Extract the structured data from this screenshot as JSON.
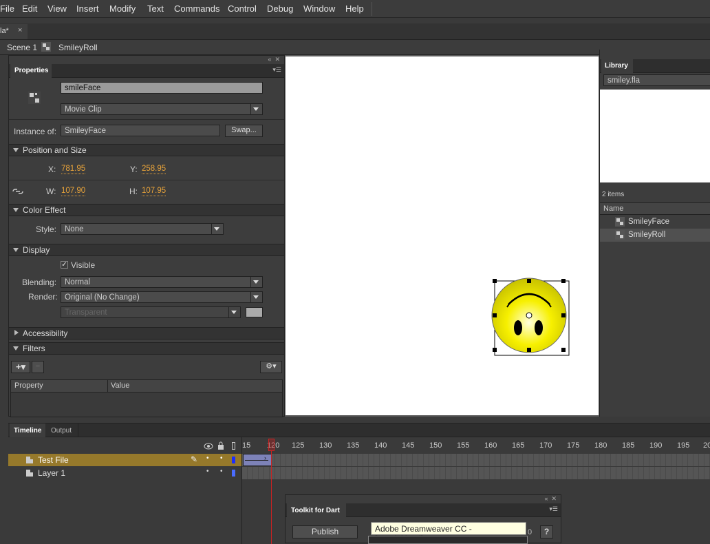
{
  "menu": [
    "File",
    "Edit",
    "View",
    "Insert",
    "Modify",
    "Text",
    "Commands",
    "Control",
    "Debug",
    "Window",
    "Help"
  ],
  "doc_tab": {
    "label": "la*",
    "close": "×"
  },
  "breadcrumb": {
    "scene": "Scene 1",
    "symbol": "SmileyRoll"
  },
  "properties": {
    "tab": "Properties",
    "instance_name": "smileFace",
    "symbol_type": "Movie Clip",
    "instance_of_label": "Instance of:",
    "instance_of": "SmileyFace",
    "swap_label": "Swap...",
    "position_size": {
      "header": "Position and Size",
      "x_label": "X:",
      "x": "781.95",
      "y_label": "Y:",
      "y": "258.95",
      "w_label": "W:",
      "w": "107.90",
      "h_label": "H:",
      "h": "107.95"
    },
    "color_effect": {
      "header": "Color Effect",
      "style_label": "Style:",
      "style": "None"
    },
    "display": {
      "header": "Display",
      "visible_label": "Visible",
      "blending_label": "Blending:",
      "blending": "Normal",
      "render_label": "Render:",
      "render": "Original (No Change)",
      "bg": "Transparent"
    },
    "accessibility": "Accessibility",
    "filters": {
      "header": "Filters",
      "col_property": "Property",
      "col_value": "Value"
    }
  },
  "library": {
    "tab": "Library",
    "file": "smiley.fla",
    "count": "2 items",
    "col_name": "Name",
    "items": [
      "SmileyFace",
      "SmileyRoll"
    ]
  },
  "timeline": {
    "tabs": [
      "Timeline",
      "Output"
    ],
    "layers": [
      "Test File",
      "Layer 1"
    ],
    "ticks": [
      "15",
      "120",
      "125",
      "130",
      "135",
      "140",
      "145",
      "150",
      "155",
      "160",
      "165",
      "170",
      "175",
      "180",
      "185",
      "190",
      "195",
      "20"
    ]
  },
  "toolkit": {
    "tab": "Toolkit for Dart",
    "publish": "Publish",
    "tooltip": "Adobe Dreamweaver CC - [special.html]",
    "trailing": "0",
    "help": "?"
  },
  "colors": {
    "accent": "#e8a33a",
    "selected_layer": "#96792b",
    "smiley": "#f7f000"
  }
}
